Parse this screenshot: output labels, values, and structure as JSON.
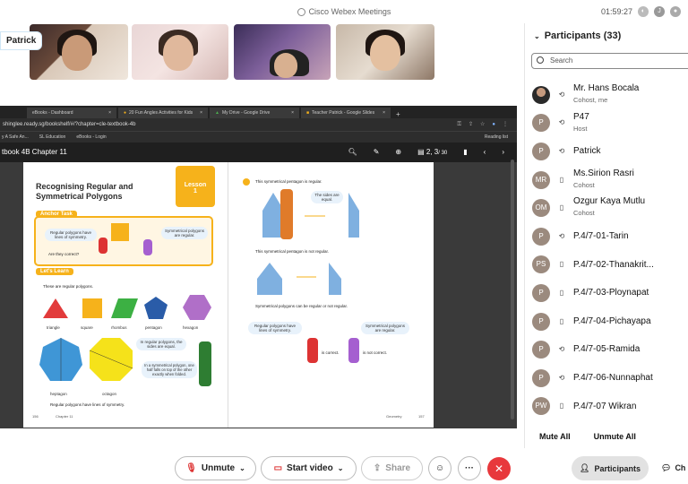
{
  "titlebar": {
    "app_name": "Cisco Webex Meetings",
    "time": "01:59:27"
  },
  "video": {
    "name_tag": "Patrick"
  },
  "shared_screen": {
    "tabs": [
      "eBooks - Dashboard",
      "20 Fun Angles Activities for Kids",
      "My Drive - Google Drive",
      "Teacher Patrick - Google Slides"
    ],
    "url": "shinglee.ready.sg/bookshelf/#/?chapter=cle-textbook-4b",
    "bookmarks": [
      "y A Safe An...",
      "SL Education",
      "eBooks - Login"
    ],
    "reading_list": "Reading list",
    "book_title": "tbook 4B Chapter 11",
    "page_indicator": "2, 3",
    "page_total": "/ 30",
    "left_page": {
      "lesson": "Lesson",
      "lesson_no": "1",
      "title_line1": "Recognising Regular and",
      "title_line2": "Symmetrical Polygons",
      "anchor_task": "Anchor Task",
      "bubble1": "Regular polygons have lines of symmetry.",
      "bubble2": "Symmetrical polygons are regular.",
      "are_they_correct": "Are they correct?",
      "lets_learn": "Let's Learn",
      "step1": "These are regular polygons.",
      "shapes": [
        "triangle",
        "square",
        "rhombus",
        "pentagon",
        "hexagon"
      ],
      "shapes2": [
        "heptagon",
        "octagon"
      ],
      "bubble3": "In regular polygons, the sides are equal.",
      "bubble4": "In a symmetrical polygon, one half falls on top of the other exactly when folded.",
      "caption": "Regular polygons have lines of symmetry.",
      "footer_left": "156",
      "footer_chapter": "Chapter 11"
    },
    "right_page": {
      "step2": "This symmetrical pentagon is regular.",
      "sides_equal": "The sides are equal.",
      "not_regular": "This symmetrical pentagon is not regular.",
      "can_be": "Symmetrical polygons can be regular or not regular.",
      "bubble_a": "Regular polygons have lines of symmetry.",
      "bubble_b": "Symmetrical polygons are regular.",
      "is_correct": "is correct.",
      "is_not_correct": "is not correct.",
      "footer_subject": "Geometry",
      "footer_right": "157"
    }
  },
  "participants": {
    "header": "Participants (33)",
    "search_placeholder": "Search",
    "list": [
      {
        "initials": "",
        "name": "Mr. Hans Bocala",
        "role": "Cohost, me",
        "device": "sync"
      },
      {
        "initials": "P",
        "name": "P47",
        "role": "Host",
        "device": "sync"
      },
      {
        "initials": "P",
        "name": "Patrick",
        "role": "",
        "device": "sync"
      },
      {
        "initials": "MR",
        "name": "Ms.Sirion Rasri",
        "role": "Cohost",
        "device": "phone"
      },
      {
        "initials": "OM",
        "name": "Ozgur Kaya Mutlu",
        "role": "Cohost",
        "device": "phone"
      },
      {
        "initials": "P",
        "name": "P.4/7-01-Tarin",
        "role": "",
        "device": "sync"
      },
      {
        "initials": "PS",
        "name": "P.4/7-02-Thanakrit...",
        "role": "",
        "device": "phone"
      },
      {
        "initials": "P",
        "name": "P.4/7-03-Ploynapat",
        "role": "",
        "device": "phone"
      },
      {
        "initials": "P",
        "name": "P.4/7-04-Pichayapa",
        "role": "",
        "device": "phone"
      },
      {
        "initials": "P",
        "name": "P.4/7-05-Ramida",
        "role": "",
        "device": "sync"
      },
      {
        "initials": "P",
        "name": "P.4/7-06-Nunnaphat",
        "role": "",
        "device": "sync"
      },
      {
        "initials": "PW",
        "name": "P.4/7-07 Wikran",
        "role": "",
        "device": "phone"
      }
    ],
    "mute_all": "Mute All",
    "unmute_all": "Unmute All"
  },
  "controls": {
    "unmute": "Unmute",
    "start_video": "Start video",
    "share": "Share",
    "participants": "Participants",
    "chat": "Ch"
  },
  "colors": {
    "accent": "#f6b21b",
    "end_call": "#e8383c"
  }
}
